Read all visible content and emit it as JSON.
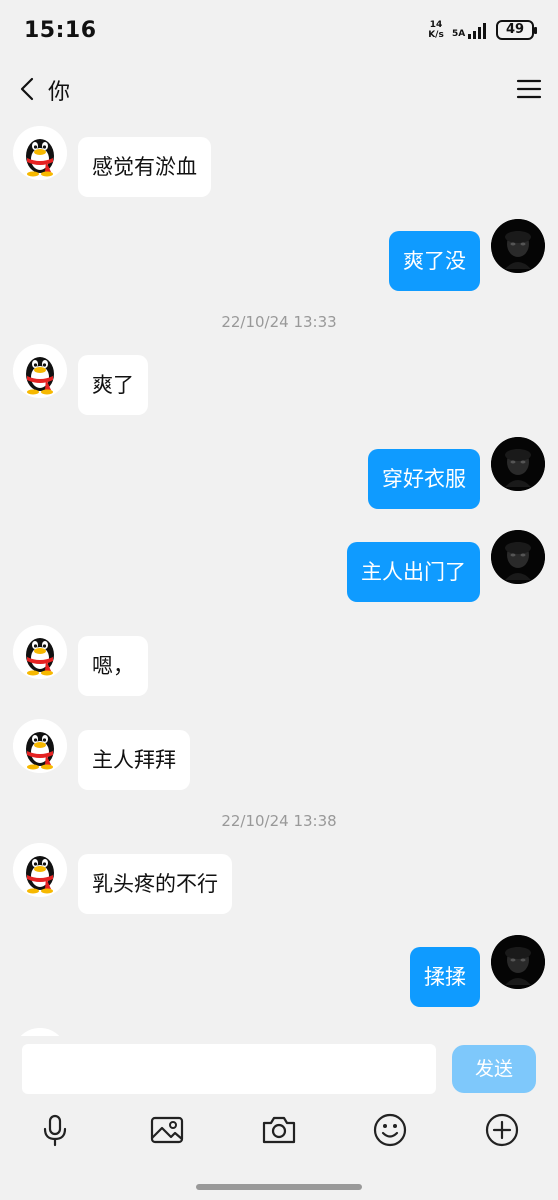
{
  "status_bar": {
    "time": "15:16",
    "net_speed_value": "14",
    "net_speed_unit": "K/s",
    "network": "5A",
    "battery": "49"
  },
  "header": {
    "title": "你",
    "back_icon": "chevron-left-icon",
    "menu_icon": "hamburger-menu-icon"
  },
  "messages": [
    {
      "side": "left",
      "text": "感觉有淤血"
    },
    {
      "side": "right",
      "text": "爽了没"
    },
    {
      "timestamp": "22/10/24 13:33"
    },
    {
      "side": "left",
      "text": "爽了"
    },
    {
      "side": "right",
      "text": "穿好衣服"
    },
    {
      "side": "right",
      "text": "主人出门了"
    },
    {
      "side": "left",
      "text": "嗯，"
    },
    {
      "side": "left",
      "text": "主人拜拜"
    },
    {
      "timestamp": "22/10/24 13:38"
    },
    {
      "side": "left",
      "text": "乳头疼的不行"
    },
    {
      "side": "right",
      "text": "揉揉"
    }
  ],
  "input": {
    "value": "",
    "placeholder": "",
    "send_label": "发送"
  },
  "toolbar": [
    "microphone-icon",
    "image-icon",
    "camera-icon",
    "emoji-icon",
    "plus-circle-icon"
  ],
  "colors": {
    "background": "#f1f1f1",
    "bubble_self": "#0f9bff",
    "bubble_other": "#ffffff",
    "send_button": "#7ec8fb",
    "timestamp": "#999999"
  }
}
